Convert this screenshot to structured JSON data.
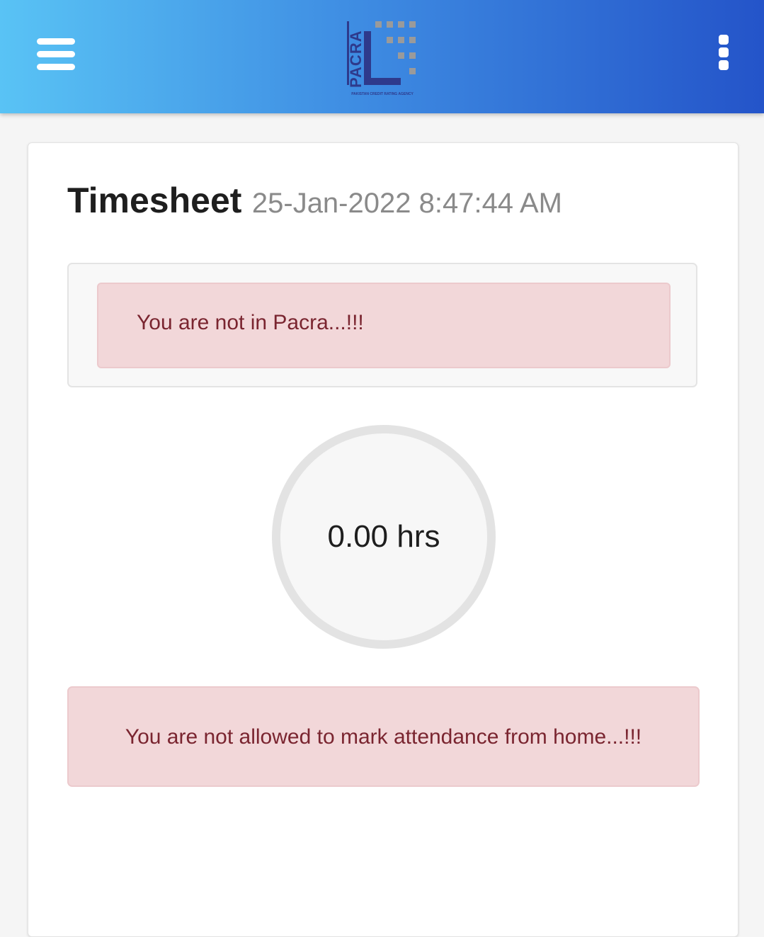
{
  "header": {
    "menu_icon": "hamburger-menu-icon",
    "logo": {
      "brand": "PACRA",
      "tagline": "PAKISTAN CREDIT RATING AGENCY"
    },
    "more_icon": "more-vertical-icon"
  },
  "timesheet": {
    "title": "Timesheet",
    "datetime": "25-Jan-2022 8:47:44 AM",
    "location_alert": "You are not in Pacra...!!!",
    "hours": "0.00 hrs",
    "attendance_alert": "You are not allowed to mark attendance from home...!!!"
  },
  "colors": {
    "header_gradient_start": "#59c3f5",
    "header_gradient_end": "#2454c9",
    "alert_background": "#f2d7d9",
    "alert_text": "#7a2530",
    "logo_dark": "#2e3a8c",
    "logo_grey": "#9a9a9a"
  }
}
